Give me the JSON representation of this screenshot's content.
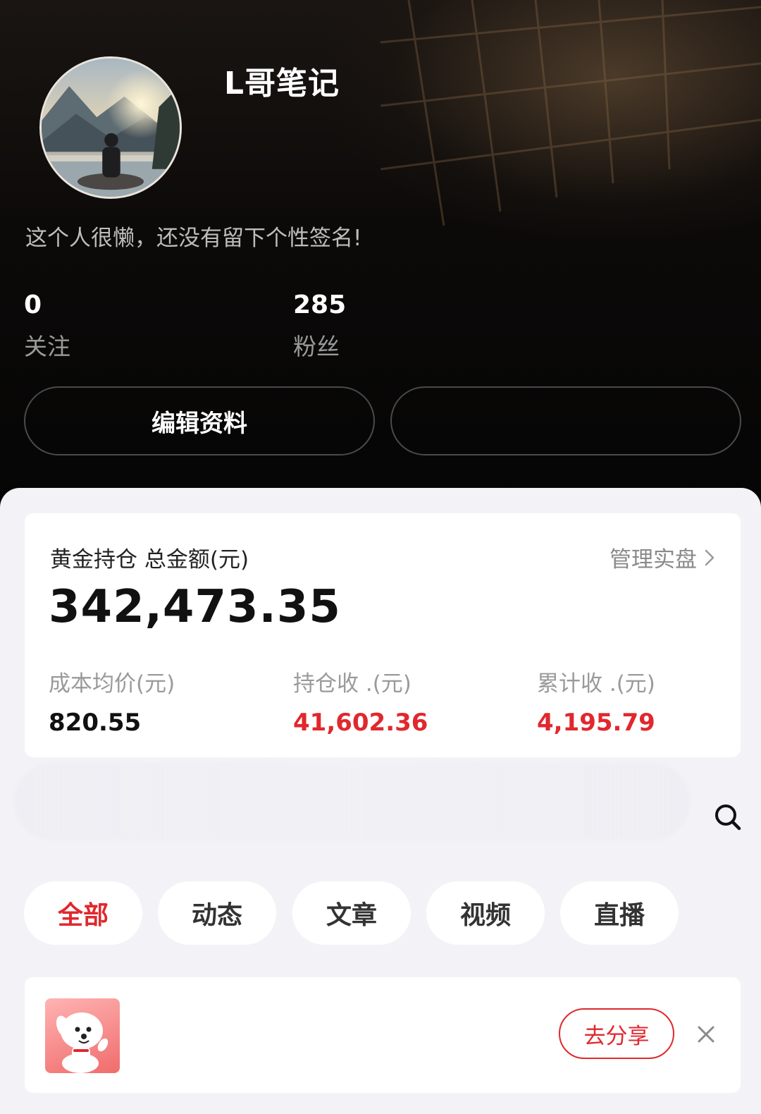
{
  "profile": {
    "username": "L哥笔记",
    "bio": "这个人很懒，还没有留下个性签名!",
    "stats": [
      {
        "value": "0",
        "label": "关注"
      },
      {
        "value": "285",
        "label": "粉丝"
      }
    ],
    "edit_button": "编辑资料"
  },
  "gold": {
    "title": "黄金持仓 总金额(元)",
    "manage_label": "管理实盘",
    "total": "342,473.35",
    "metrics": [
      {
        "label": "成本均价(元)",
        "value": "820.55"
      },
      {
        "label": "持仓收 .(元)",
        "value": "41,602.36"
      },
      {
        "label": "累计收 .(元)",
        "value": "4,195.79"
      }
    ]
  },
  "tabs": [
    {
      "label": "全部",
      "active": true
    },
    {
      "label": "动态",
      "active": false
    },
    {
      "label": "文章",
      "active": false
    },
    {
      "label": "视频",
      "active": false
    },
    {
      "label": "直播",
      "active": false
    }
  ],
  "share_card": {
    "button": "去分享"
  },
  "colors": {
    "accent_red": "#e0282e",
    "header_bg": "#0c0a09",
    "sheet_bg": "#f3f3f7"
  },
  "icons": [
    "search-icon",
    "chevron-right-icon",
    "close-icon",
    "jd-dog-logo"
  ]
}
